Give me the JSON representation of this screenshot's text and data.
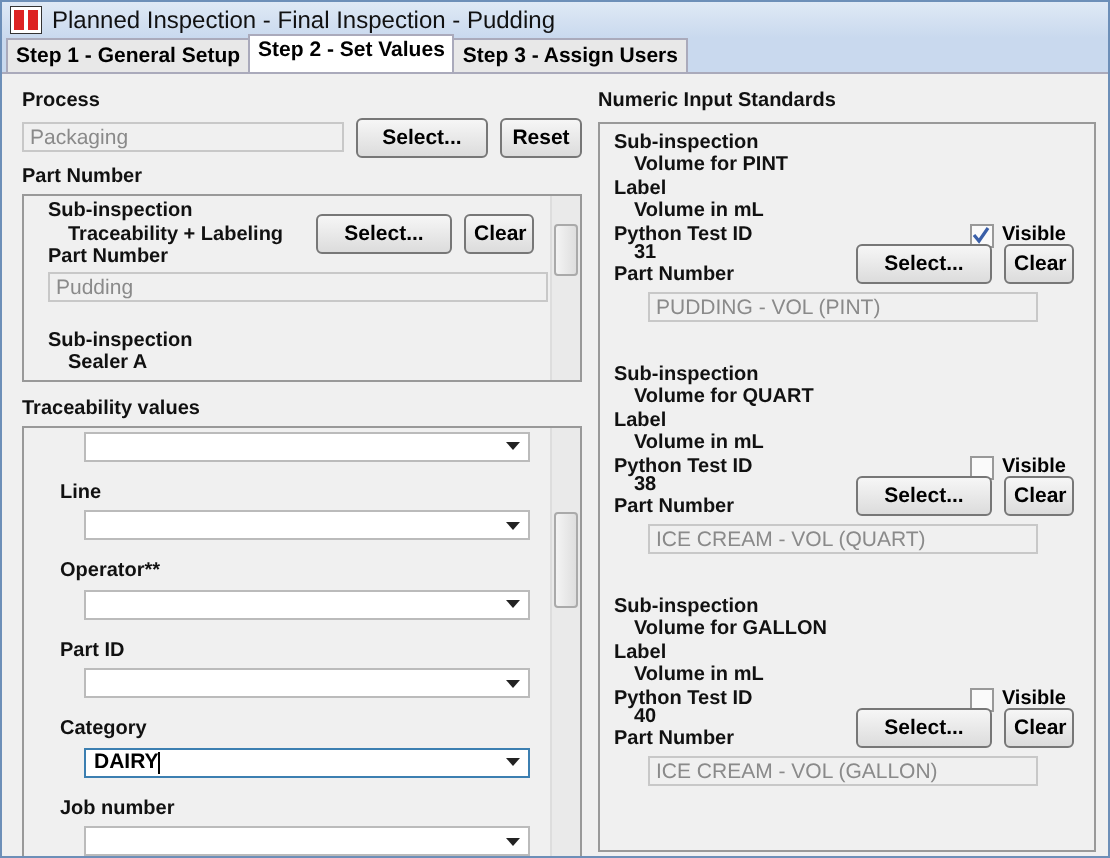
{
  "window": {
    "title": "Planned Inspection  - Final Inspection - Pudding"
  },
  "tabs": [
    {
      "label": "Step 1 - General Setup",
      "selected": false
    },
    {
      "label": "Step 2 - Set Values",
      "selected": true
    },
    {
      "label": "Step 3 - Assign Users",
      "selected": false
    }
  ],
  "process": {
    "label": "Process",
    "value": "Packaging",
    "buttons": [
      "Select...",
      "Reset"
    ]
  },
  "part_number": {
    "label": "Part Number",
    "entries": [
      {
        "sub_label": "Sub-inspection",
        "sub_value": "Traceability + Labeling",
        "part_label": "Part Number",
        "part_value": "Pudding",
        "buttons": [
          "Select...",
          "Clear"
        ]
      },
      {
        "sub_label": "Sub-inspection",
        "sub_value": "Sealer A"
      }
    ]
  },
  "traceability": {
    "label": "Traceability values",
    "fields": [
      {
        "focused": false
      },
      {
        "label": "Line",
        "focused": false
      },
      {
        "label": "Operator**",
        "focused": false
      },
      {
        "label": "Part ID",
        "focused": false
      },
      {
        "label": "Category",
        "value": "DAIRY",
        "focused": true
      },
      {
        "label": "Job number",
        "focused": false
      }
    ]
  },
  "numeric": {
    "label": "Numeric Input Standards",
    "entries": [
      {
        "sub_label": "Sub-inspection",
        "sub_value": "Volume for PINT",
        "label_label": "Label",
        "label_value": "Volume in mL",
        "test_label": "Python Test ID",
        "test_value": "31",
        "visible_label": "Visible",
        "visible": true,
        "part_label": "Part Number",
        "part_value": "PUDDING - VOL (PINT)",
        "buttons": [
          "Select...",
          "Clear"
        ]
      },
      {
        "sub_label": "Sub-inspection",
        "sub_value": "Volume for QUART",
        "label_label": "Label",
        "label_value": "Volume in mL",
        "test_label": "Python Test ID",
        "test_value": "38",
        "visible_label": "Visible",
        "visible": false,
        "part_label": "Part Number",
        "part_value": "ICE CREAM - VOL (QUART)",
        "buttons": [
          "Select...",
          "Clear"
        ]
      },
      {
        "sub_label": "Sub-inspection",
        "sub_value": "Volume for GALLON",
        "label_label": "Label",
        "label_value": "Volume in mL",
        "test_label": "Python Test ID",
        "test_value": "40",
        "visible_label": "Visible",
        "visible": false,
        "part_label": "Part Number",
        "part_value": "ICE CREAM - VOL (GALLON)",
        "buttons": [
          "Select...",
          "Clear"
        ]
      }
    ]
  }
}
